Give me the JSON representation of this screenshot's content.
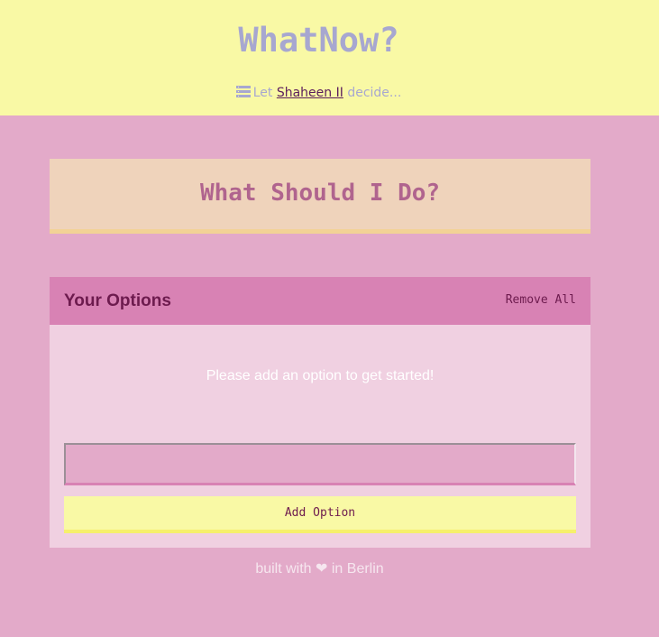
{
  "header": {
    "title": "WhatNow?",
    "tagline_prefix": "Let",
    "author_link": "Shaheen II",
    "tagline_suffix": "decide...",
    "icon": "stack-icon"
  },
  "question": {
    "title": "What Should I Do?"
  },
  "options": {
    "title": "Your Options",
    "remove_all_label": "Remove All",
    "empty_message": "Please add an option to get started!",
    "input_value": "",
    "input_placeholder": "",
    "add_label": "Add Option"
  },
  "footer": {
    "prefix": "built with",
    "heart": "❤",
    "suffix": "in Berlin"
  },
  "colors": {
    "header_bg": "#f9f9a5",
    "page_bg": "#e3aac9",
    "title": "#a7a7d0",
    "link": "#5b1d5c",
    "question_bg": "#efd3bb",
    "options_header_bg": "#d882b4",
    "options_body_bg": "#f0d0e1"
  }
}
